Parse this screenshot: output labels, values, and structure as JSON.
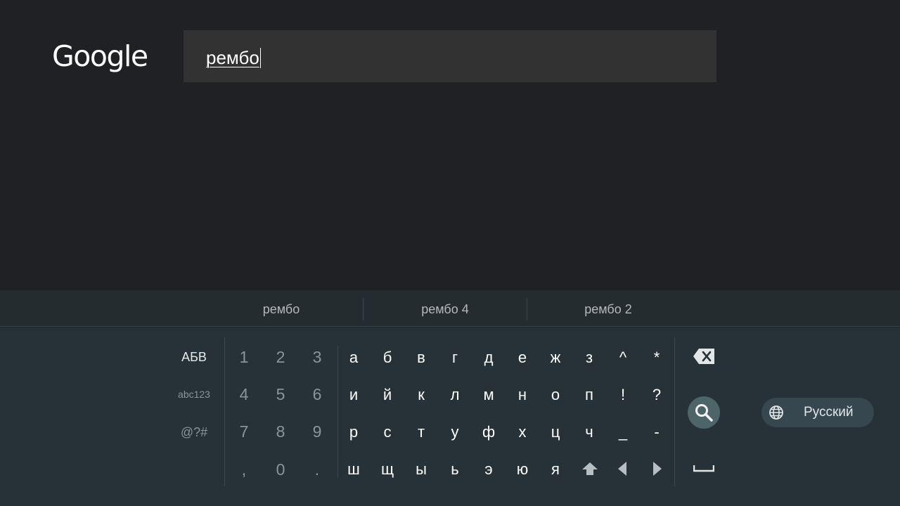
{
  "logo": {
    "text": "Google"
  },
  "search": {
    "query": "рембо"
  },
  "suggestions": [
    "рембо",
    "рембо 4",
    "рембо 2"
  ],
  "modes": {
    "cyrillic": "АБВ",
    "latin": "abc123",
    "symbols": "@?#"
  },
  "numpad": [
    "1",
    "2",
    "3",
    "4",
    "5",
    "6",
    "7",
    "8",
    "9",
    ",",
    "0",
    "."
  ],
  "letters": [
    [
      "а",
      "б",
      "в",
      "г",
      "д",
      "е",
      "ж",
      "з",
      "^",
      "*"
    ],
    [
      "и",
      "й",
      "к",
      "л",
      "м",
      "н",
      "о",
      "п",
      "!",
      "?"
    ],
    [
      "р",
      "с",
      "т",
      "у",
      "ф",
      "х",
      "ц",
      "ч",
      "_",
      "-"
    ],
    [
      "ш",
      "щ",
      "ы",
      "ь",
      "э",
      "ю",
      "я"
    ]
  ],
  "language": {
    "label": "Русский"
  },
  "colors": {
    "background": "#202124",
    "keyboard": "#263238",
    "search_button": "#4d6469",
    "language_pill": "#37474f"
  },
  "icons": [
    "backspace-icon",
    "search-icon",
    "space-icon",
    "shift-icon",
    "arrow-left-icon",
    "arrow-right-icon",
    "globe-icon"
  ]
}
